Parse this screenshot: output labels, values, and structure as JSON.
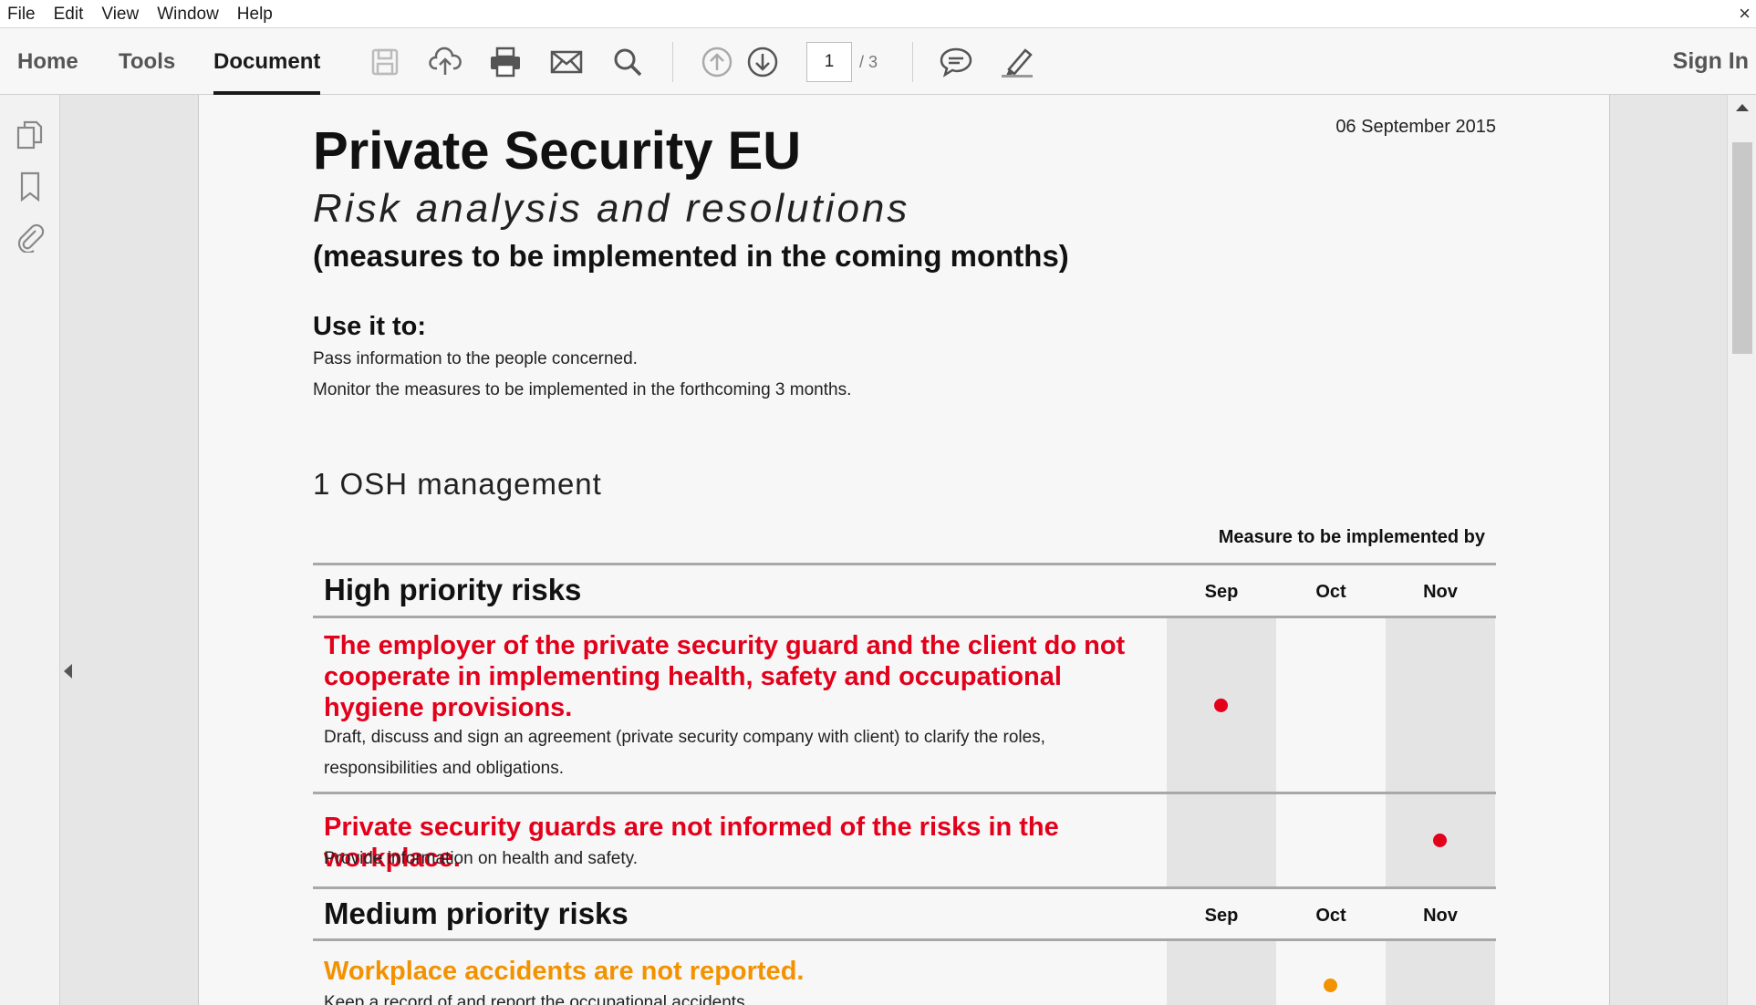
{
  "menu": {
    "items": [
      "File",
      "Edit",
      "View",
      "Window",
      "Help"
    ],
    "close": "×"
  },
  "toolbar": {
    "tabs": [
      "Home",
      "Tools",
      "Document"
    ],
    "active_tab": "Document",
    "page_current": "1",
    "page_total": "/ 3",
    "sign_in": "Sign In",
    "icons": [
      "save-icon",
      "upload-icon",
      "print-icon",
      "email-icon",
      "search-icon",
      "prev-page-icon",
      "next-page-icon",
      "comment-icon",
      "highlight-pen-icon"
    ]
  },
  "left_rail": {
    "icons": [
      "pages-icon",
      "bookmark-icon",
      "attachment-icon"
    ]
  },
  "document": {
    "title": "Private Security EU",
    "subtitle": "Risk analysis and resolutions",
    "subnote": "(measures to be implemented in the coming months)",
    "date": "06 September 2015",
    "use_heading": "Use it to:",
    "use_lines": [
      "Pass information to the people concerned.",
      "Monitor the measures to be implemented in the forthcoming 3 months."
    ],
    "section_title": "1 OSH management",
    "measure_label": "Measure to be implemented by",
    "months": [
      "Sep",
      "Oct",
      "Nov"
    ],
    "high_heading": "High priority risks",
    "medium_heading": "Medium priority risks",
    "risks": [
      {
        "title": "The employer of the private security guard and the client do not cooperate in implementing health, safety and occupational hygiene provisions.",
        "description": "Draft, discuss and sign an agreement (private security company with client) to clarify the roles, responsibilities and obligations.",
        "priority": "high",
        "month": "Sep"
      },
      {
        "title": "Private security guards are not informed of the risks in the workplace.",
        "description": "Provide information on health and safety.",
        "priority": "high",
        "month": "Nov"
      },
      {
        "title": "Workplace accidents are not reported.",
        "description": "Keep a record of and report the occupational accidents.",
        "priority": "medium",
        "month": "Oct"
      }
    ],
    "colors": {
      "high": "#e3001b",
      "medium": "#f39200",
      "shade": "#e4e4e4"
    }
  }
}
